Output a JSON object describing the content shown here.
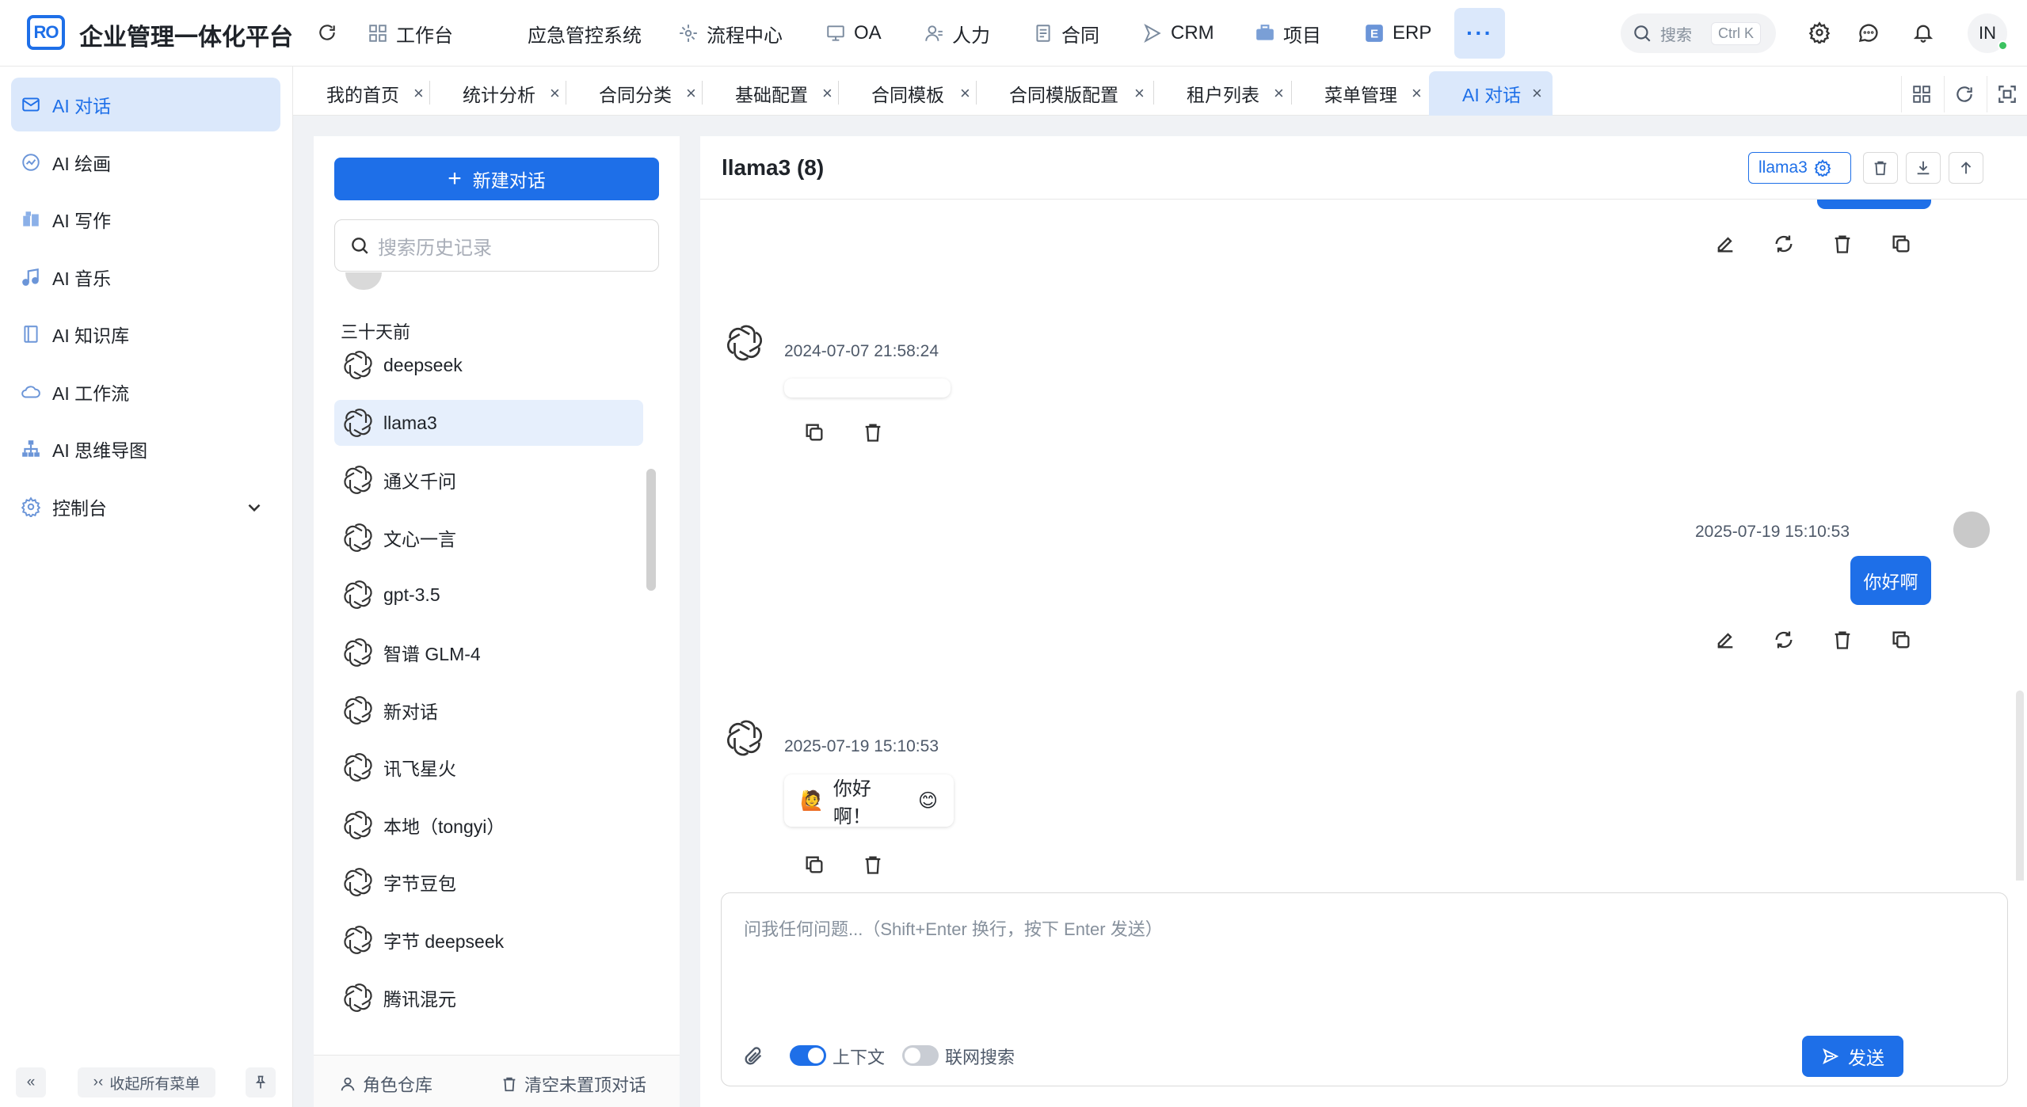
{
  "header": {
    "logo_text": "RO",
    "app_title": "企业管理一体化平台",
    "nav": [
      {
        "label": "工作台",
        "icon": "dashboard-icon"
      },
      {
        "label": "应急管控系统",
        "icon": ""
      },
      {
        "label": "流程中心",
        "icon": "workflow-icon"
      },
      {
        "label": "OA",
        "icon": "monitor-icon"
      },
      {
        "label": "人力",
        "icon": "user-icon"
      },
      {
        "label": "合同",
        "icon": "document-icon"
      },
      {
        "label": "CRM",
        "icon": "send-icon"
      },
      {
        "label": "项目",
        "icon": "briefcase-icon"
      },
      {
        "label": "ERP",
        "icon": "erp-icon"
      }
    ],
    "more_label": "···",
    "search_placeholder": "搜索",
    "search_shortcut": "Ctrl K",
    "avatar_initials": "IN"
  },
  "sidebar": {
    "items": [
      {
        "label": "AI 对话",
        "icon": "mail-icon",
        "active": true
      },
      {
        "label": "AI 绘画",
        "icon": "palette-icon"
      },
      {
        "label": "AI 写作",
        "icon": "book-icon"
      },
      {
        "label": "AI 音乐",
        "icon": "music-icon"
      },
      {
        "label": "AI 知识库",
        "icon": "notebook-icon"
      },
      {
        "label": "AI 工作流",
        "icon": "cloud-icon"
      },
      {
        "label": "AI 思维导图",
        "icon": "sitemap-icon"
      },
      {
        "label": "控制台",
        "icon": "gear-icon"
      }
    ],
    "collapse_label": "收起所有菜单"
  },
  "tabs": [
    {
      "label": "我的首页"
    },
    {
      "label": "统计分析"
    },
    {
      "label": "合同分类"
    },
    {
      "label": "基础配置"
    },
    {
      "label": "合同模板"
    },
    {
      "label": "合同模版配置"
    },
    {
      "label": "租户列表"
    },
    {
      "label": "菜单管理"
    },
    {
      "label": "AI 对话",
      "active": true
    }
  ],
  "conversations": {
    "new_chat_label": "新建对话",
    "search_placeholder": "搜索历史记录",
    "group_label": "三十天前",
    "items": [
      {
        "title": "deepseek"
      },
      {
        "title": "llama3",
        "active": true
      },
      {
        "title": "通义千问"
      },
      {
        "title": "文心一言"
      },
      {
        "title": "gpt-3.5"
      },
      {
        "title": "智谱 GLM-4"
      },
      {
        "title": "新对话"
      },
      {
        "title": "讯飞星火"
      },
      {
        "title": "本地（tongyi）"
      },
      {
        "title": "字节豆包"
      },
      {
        "title": "字节 deepseek"
      },
      {
        "title": "腾讯混元"
      }
    ],
    "footer_role_label": "角色仓库",
    "footer_clear_label": "清空未置顶对话"
  },
  "chat": {
    "title": "llama3 (8)",
    "model_tag": "llama3",
    "messages": [
      {
        "role": "assistant",
        "timestamp": "2024-07-07 21:58:24",
        "text": ""
      },
      {
        "role": "user",
        "timestamp": "2025-07-19 15:10:53",
        "text": "你好啊"
      },
      {
        "role": "assistant",
        "timestamp": "2025-07-19 15:10:53",
        "text": "你好啊！",
        "emoji_before": "🙋",
        "emoji_after": "😊"
      }
    ],
    "input_placeholder": "问我任何问题...（Shift+Enter 换行，按下 Enter 发送）",
    "context_label": "上下文",
    "context_on": true,
    "web_search_label": "联网搜索",
    "web_search_on": false,
    "send_label": "发送"
  },
  "colors": {
    "primary": "#1e6fe8",
    "active_bg": "#dbe8fb"
  }
}
